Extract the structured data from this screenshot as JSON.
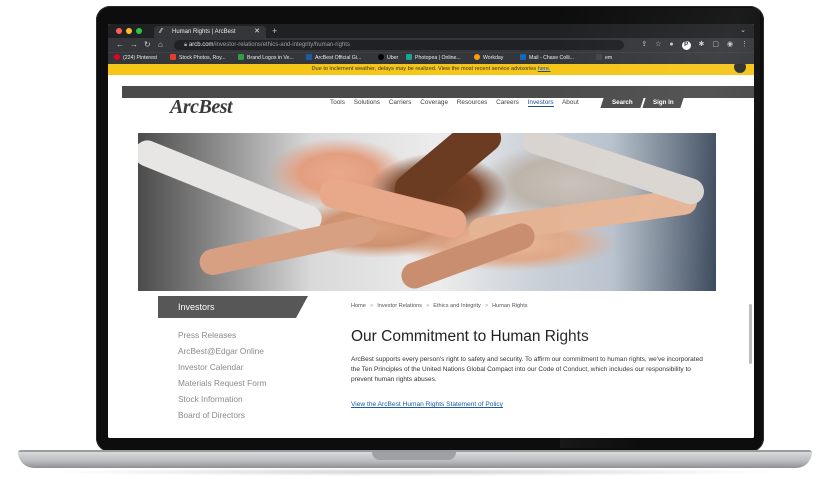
{
  "browser": {
    "tab_title": "Human Rights | ArcBest",
    "new_tab_icon": "plus-icon",
    "url_host": "arcb.com",
    "url_path": "/investor-relations/ethics-and-integrity/human-rights",
    "bookmarks": [
      {
        "label": "(224) Pinterest",
        "color": "#e60023"
      },
      {
        "label": "Stock Photos, Roy...",
        "color": "#e23d2d"
      },
      {
        "label": "Brand Logos in Ve...",
        "color": "#f0b400"
      },
      {
        "label": "ArcBest Official Gi...",
        "color": "#1c5aa8"
      },
      {
        "label": "Uber",
        "color": "#000000"
      },
      {
        "label": "Photopea | Online...",
        "color": "#18a497"
      },
      {
        "label": "Workday",
        "color": "#f59e0b"
      },
      {
        "label": "Mail - Chase Colli...",
        "color": "#0f6cbd"
      },
      {
        "label": "em",
        "color": "#444444"
      }
    ]
  },
  "alert": {
    "text": "Due to inclement weather, delays may be realized. View the most recent service advisories ",
    "link": "here."
  },
  "header": {
    "logo": "ArcBest",
    "nav": [
      "Tools",
      "Solutions",
      "Carriers",
      "Coverage",
      "Resources",
      "Careers",
      "Investors",
      "About"
    ],
    "active_nav": "Investors",
    "search_label": "Search",
    "signin_label": "Sign In"
  },
  "sidebar": {
    "title": "Investors",
    "items": [
      "Press Releases",
      "ArcBest@Edgar Online",
      "Investor Calendar",
      "Materials Request Form",
      "Stock Information",
      "Board of Directors"
    ]
  },
  "breadcrumb": [
    "Home",
    "Investor Relations",
    "Ethics and Integrity",
    "Human Rights"
  ],
  "main": {
    "title": "Our Commitment to Human Rights",
    "paragraph": "ArcBest supports every person's right to safety and security. To affirm our commitment to human rights, we've incorporated the Ten Principles of the United Nations Global Compact into our Code of Conduct, which includes our responsibility to prevent human rights abuses.",
    "policy_link": "View the ArcBest Human Rights Statement of Policy"
  }
}
